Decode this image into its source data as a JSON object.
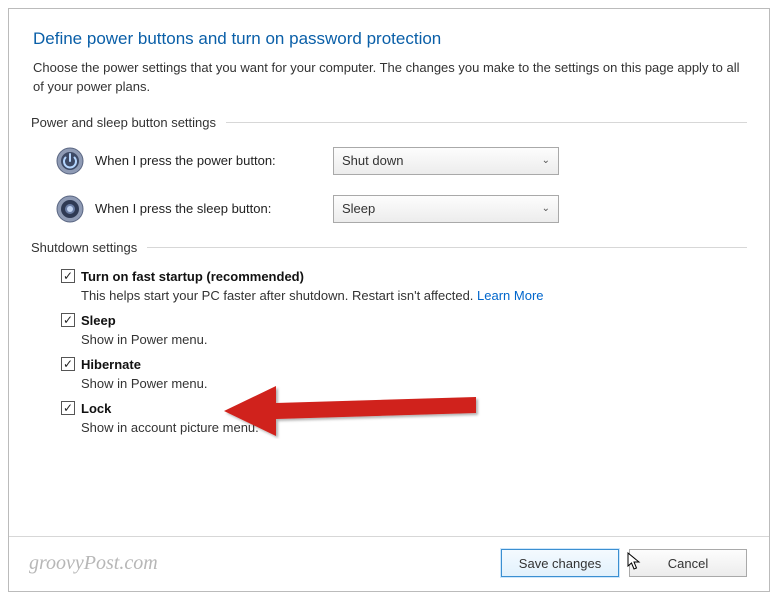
{
  "page": {
    "title": "Define power buttons and turn on password protection",
    "description": "Choose the power settings that you want for your computer. The changes you make to the settings on this page apply to all of your power plans."
  },
  "sections": {
    "power_sleep": {
      "header": "Power and sleep button settings",
      "rows": [
        {
          "label": "When I press the power button:",
          "value": "Shut down"
        },
        {
          "label": "When I press the sleep button:",
          "value": "Sleep"
        }
      ]
    },
    "shutdown": {
      "header": "Shutdown settings",
      "items": [
        {
          "title": "Turn on fast startup (recommended)",
          "desc_prefix": "This helps start your PC faster after shutdown. Restart isn't affected. ",
          "link": "Learn More",
          "checked": true
        },
        {
          "title": "Sleep",
          "desc": "Show in Power menu.",
          "checked": true
        },
        {
          "title": "Hibernate",
          "desc": "Show in Power menu.",
          "checked": true
        },
        {
          "title": "Lock",
          "desc": "Show in account picture menu.",
          "checked": true
        }
      ]
    }
  },
  "buttons": {
    "save": "Save changes",
    "cancel": "Cancel"
  },
  "watermark": "groovyPost.com"
}
